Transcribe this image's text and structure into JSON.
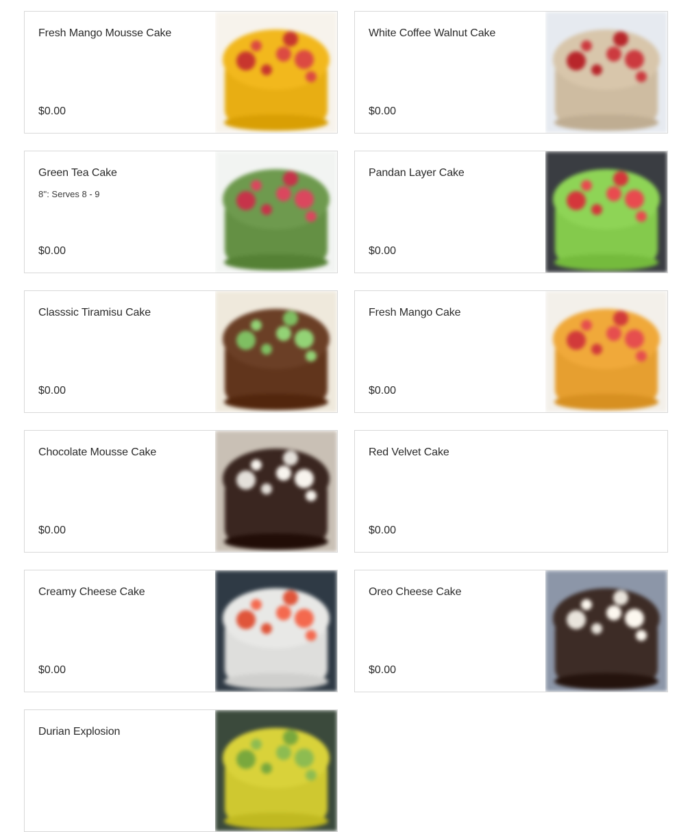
{
  "items": [
    {
      "name": "Fresh Mango Mousse Cake",
      "description": "",
      "price": "$0.00",
      "image": "mango-mousse",
      "colors": {
        "bg": "#f7f3ec",
        "main": "#f2b81d",
        "accent": "#c8362e"
      }
    },
    {
      "name": "White Coffee Walnut Cake",
      "description": "",
      "price": "$0.00",
      "image": "coffee-walnut",
      "colors": {
        "bg": "#e6eaf0",
        "main": "#d8c6ab",
        "accent": "#b8262b"
      }
    },
    {
      "name": "Green Tea Cake",
      "description": "8'': Serves 8 - 9",
      "price": "$0.00",
      "image": "green-tea",
      "colors": {
        "bg": "#f2f4f2",
        "main": "#6e9a4e",
        "accent": "#c7334a"
      }
    },
    {
      "name": "Pandan Layer Cake",
      "description": "",
      "price": "$0.00",
      "image": "pandan",
      "colors": {
        "bg": "#3a3d42",
        "main": "#8ed456",
        "accent": "#d5363b"
      }
    },
    {
      "name": "Classsic Tiramisu Cake",
      "description": "",
      "price": "$0.00",
      "image": "tiramisu",
      "colors": {
        "bg": "#efe9dc",
        "main": "#6b3f26",
        "accent": "#7fbf62"
      }
    },
    {
      "name": "Fresh Mango Cake",
      "description": "",
      "price": "$0.00",
      "image": "mango-cake",
      "colors": {
        "bg": "#f3f0ea",
        "main": "#f0a93a",
        "accent": "#d23a3a"
      }
    },
    {
      "name": "Chocolate Mousse Cake",
      "description": "",
      "price": "$0.00",
      "image": "chocolate-mousse",
      "colors": {
        "bg": "#c9c0b5",
        "main": "#3a2620",
        "accent": "#e4e0da"
      }
    },
    {
      "name": "Red Velvet Cake",
      "description": "",
      "price": "$0.00",
      "image": null,
      "colors": {
        "bg": "#ffffff",
        "main": "#ffffff",
        "accent": "#ffffff"
      }
    },
    {
      "name": "Creamy Cheese Cake",
      "description": "",
      "price": "$0.00",
      "image": "cheese-cake",
      "colors": {
        "bg": "#2f3a45",
        "main": "#e8e8e6",
        "accent": "#e0553a"
      }
    },
    {
      "name": "Oreo Cheese Cake",
      "description": "",
      "price": "$0.00",
      "image": "oreo-cheese",
      "colors": {
        "bg": "#8c96a8",
        "main": "#3d2c26",
        "accent": "#e9e4dc"
      }
    },
    {
      "name": "Durian Explosion",
      "description": "",
      "price": "",
      "image": "durian",
      "colors": {
        "bg": "#3b4a3c",
        "main": "#d9d23a",
        "accent": "#79a83d"
      }
    }
  ]
}
